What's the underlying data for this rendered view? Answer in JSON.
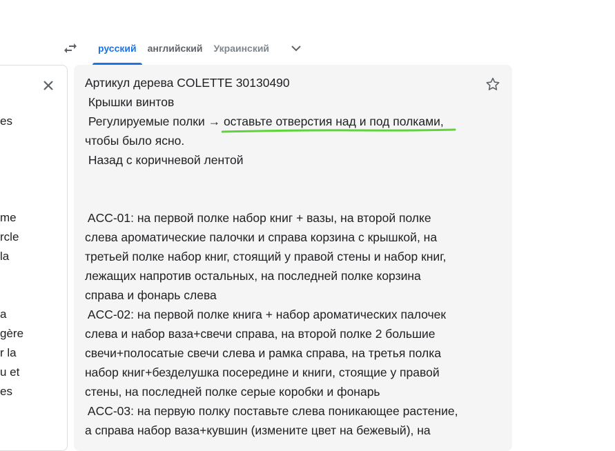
{
  "toolbar": {
    "languages": [
      "русский",
      "английский",
      "Украинский"
    ]
  },
  "source_fragments": [
    "es",
    "me",
    "rcle",
    "la",
    "a",
    "gère",
    "r la",
    "u et",
    "es"
  ],
  "translation_lines": [
    "Артикул дерева COLETTE 30130490",
    " Крышки винтов",
    " Регулируемые полки → оставьте отверстия над и под полками,",
    "чтобы было ясно.",
    " Назад с коричневой лентой",
    " ACC-01: на первой полке набор книг + вазы, на второй полке",
    "слева ароматические палочки и справа корзина с крышкой, на",
    "третьей полке набор книг, стоящий у правой стены и набор книг,",
    "лежащих напротив остальных, на последней полке корзина",
    "справа и фонарь слева",
    " ACC-02: на первой полке книга + набор ароматических палочек",
    "слева и набор ваза+свечи справа, на второй полке 2 большие",
    "свечи+полосатые свечи слева и рамка справа, на третья полка",
    "набор книг+безделушка посередине и книги, стоящие у правой",
    "стены, на последней полке серые коробки и фонарь",
    " ACC-03: на первую полку поставьте слева поникающее растение,",
    "а справа набор ваза+кувшин (измените цвет на бежевый), на"
  ],
  "colors": {
    "accent": "#1a73e8",
    "panel_bg": "#f5f5f5",
    "highlight_underline": "#5ed43a"
  }
}
